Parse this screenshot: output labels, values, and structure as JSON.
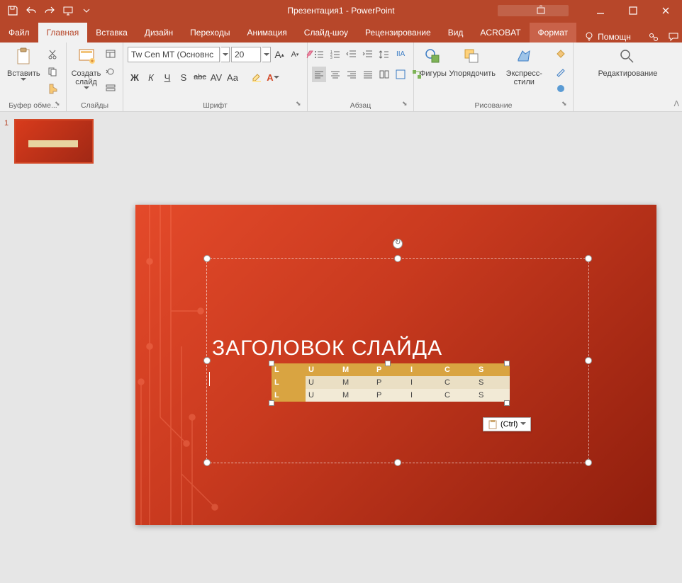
{
  "app": {
    "title": "Презентация1 - PowerPoint"
  },
  "tabs": {
    "file": "Файл",
    "home": "Главная",
    "insert": "Вставка",
    "design": "Дизайн",
    "transitions": "Переходы",
    "animation": "Анимация",
    "slideshow": "Слайд-шоу",
    "review": "Рецензирование",
    "view": "Вид",
    "acrobat": "ACROBAT",
    "format": "Формат",
    "tellme": "Помощн"
  },
  "ribbon": {
    "clipboard": {
      "paste": "Вставить",
      "label": "Буфер обме..."
    },
    "slides": {
      "new": "Создать слайд",
      "label": "Слайды"
    },
    "font": {
      "name": "Tw Cen MT (Основнс",
      "size": "20",
      "label": "Шрифт",
      "bold": "Ж",
      "italic": "К",
      "underline": "Ч",
      "strike": "S",
      "shadow": "abc",
      "spacing": "AV",
      "case": "Aa"
    },
    "paragraph": {
      "label": "Абзац"
    },
    "drawing": {
      "shapes": "Фигуры",
      "arrange": "Упорядочить",
      "styles": "Экспресс-стили",
      "label": "Рисование"
    },
    "editing": {
      "label": "Редактирование"
    }
  },
  "thumb": {
    "number": "1"
  },
  "slide": {
    "title": "ЗАГОЛОВОК СЛАЙДА",
    "table": {
      "header": [
        "L",
        "U",
        "M",
        "P",
        "I",
        "C",
        "S"
      ],
      "rows": [
        [
          "L",
          "U",
          "M",
          "P",
          "I",
          "C",
          "S"
        ],
        [
          "L",
          "U",
          "M",
          "P",
          "I",
          "C",
          "S"
        ]
      ]
    }
  },
  "paste_options": {
    "label": "(Ctrl)"
  }
}
